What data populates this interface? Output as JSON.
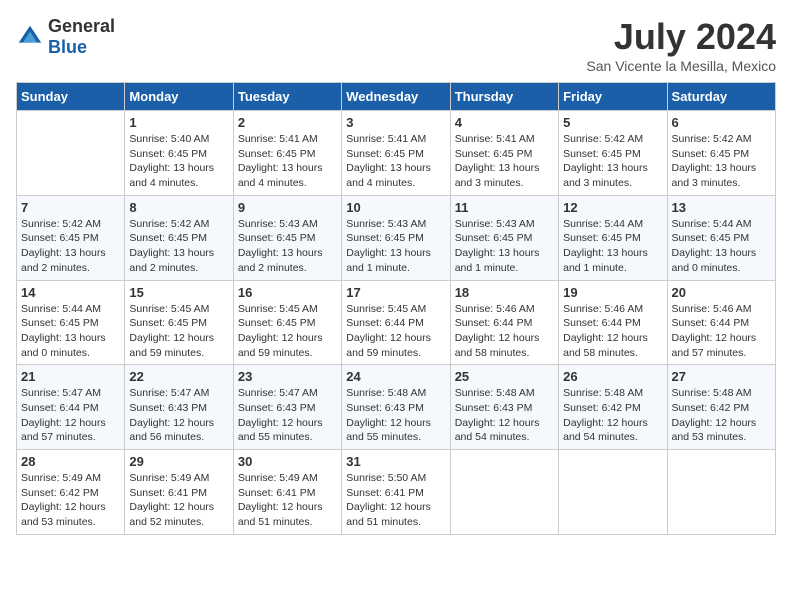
{
  "header": {
    "logo_general": "General",
    "logo_blue": "Blue",
    "month_year": "July 2024",
    "location": "San Vicente la Mesilla, Mexico"
  },
  "days_of_week": [
    "Sunday",
    "Monday",
    "Tuesday",
    "Wednesday",
    "Thursday",
    "Friday",
    "Saturday"
  ],
  "weeks": [
    [
      {
        "day": "",
        "info": ""
      },
      {
        "day": "1",
        "info": "Sunrise: 5:40 AM\nSunset: 6:45 PM\nDaylight: 13 hours and 4 minutes."
      },
      {
        "day": "2",
        "info": "Sunrise: 5:41 AM\nSunset: 6:45 PM\nDaylight: 13 hours and 4 minutes."
      },
      {
        "day": "3",
        "info": "Sunrise: 5:41 AM\nSunset: 6:45 PM\nDaylight: 13 hours and 4 minutes."
      },
      {
        "day": "4",
        "info": "Sunrise: 5:41 AM\nSunset: 6:45 PM\nDaylight: 13 hours and 3 minutes."
      },
      {
        "day": "5",
        "info": "Sunrise: 5:42 AM\nSunset: 6:45 PM\nDaylight: 13 hours and 3 minutes."
      },
      {
        "day": "6",
        "info": "Sunrise: 5:42 AM\nSunset: 6:45 PM\nDaylight: 13 hours and 3 minutes."
      }
    ],
    [
      {
        "day": "7",
        "info": "Sunrise: 5:42 AM\nSunset: 6:45 PM\nDaylight: 13 hours and 2 minutes."
      },
      {
        "day": "8",
        "info": "Sunrise: 5:42 AM\nSunset: 6:45 PM\nDaylight: 13 hours and 2 minutes."
      },
      {
        "day": "9",
        "info": "Sunrise: 5:43 AM\nSunset: 6:45 PM\nDaylight: 13 hours and 2 minutes."
      },
      {
        "day": "10",
        "info": "Sunrise: 5:43 AM\nSunset: 6:45 PM\nDaylight: 13 hours and 1 minute."
      },
      {
        "day": "11",
        "info": "Sunrise: 5:43 AM\nSunset: 6:45 PM\nDaylight: 13 hours and 1 minute."
      },
      {
        "day": "12",
        "info": "Sunrise: 5:44 AM\nSunset: 6:45 PM\nDaylight: 13 hours and 1 minute."
      },
      {
        "day": "13",
        "info": "Sunrise: 5:44 AM\nSunset: 6:45 PM\nDaylight: 13 hours and 0 minutes."
      }
    ],
    [
      {
        "day": "14",
        "info": "Sunrise: 5:44 AM\nSunset: 6:45 PM\nDaylight: 13 hours and 0 minutes."
      },
      {
        "day": "15",
        "info": "Sunrise: 5:45 AM\nSunset: 6:45 PM\nDaylight: 12 hours and 59 minutes."
      },
      {
        "day": "16",
        "info": "Sunrise: 5:45 AM\nSunset: 6:45 PM\nDaylight: 12 hours and 59 minutes."
      },
      {
        "day": "17",
        "info": "Sunrise: 5:45 AM\nSunset: 6:44 PM\nDaylight: 12 hours and 59 minutes."
      },
      {
        "day": "18",
        "info": "Sunrise: 5:46 AM\nSunset: 6:44 PM\nDaylight: 12 hours and 58 minutes."
      },
      {
        "day": "19",
        "info": "Sunrise: 5:46 AM\nSunset: 6:44 PM\nDaylight: 12 hours and 58 minutes."
      },
      {
        "day": "20",
        "info": "Sunrise: 5:46 AM\nSunset: 6:44 PM\nDaylight: 12 hours and 57 minutes."
      }
    ],
    [
      {
        "day": "21",
        "info": "Sunrise: 5:47 AM\nSunset: 6:44 PM\nDaylight: 12 hours and 57 minutes."
      },
      {
        "day": "22",
        "info": "Sunrise: 5:47 AM\nSunset: 6:43 PM\nDaylight: 12 hours and 56 minutes."
      },
      {
        "day": "23",
        "info": "Sunrise: 5:47 AM\nSunset: 6:43 PM\nDaylight: 12 hours and 55 minutes."
      },
      {
        "day": "24",
        "info": "Sunrise: 5:48 AM\nSunset: 6:43 PM\nDaylight: 12 hours and 55 minutes."
      },
      {
        "day": "25",
        "info": "Sunrise: 5:48 AM\nSunset: 6:43 PM\nDaylight: 12 hours and 54 minutes."
      },
      {
        "day": "26",
        "info": "Sunrise: 5:48 AM\nSunset: 6:42 PM\nDaylight: 12 hours and 54 minutes."
      },
      {
        "day": "27",
        "info": "Sunrise: 5:48 AM\nSunset: 6:42 PM\nDaylight: 12 hours and 53 minutes."
      }
    ],
    [
      {
        "day": "28",
        "info": "Sunrise: 5:49 AM\nSunset: 6:42 PM\nDaylight: 12 hours and 53 minutes."
      },
      {
        "day": "29",
        "info": "Sunrise: 5:49 AM\nSunset: 6:41 PM\nDaylight: 12 hours and 52 minutes."
      },
      {
        "day": "30",
        "info": "Sunrise: 5:49 AM\nSunset: 6:41 PM\nDaylight: 12 hours and 51 minutes."
      },
      {
        "day": "31",
        "info": "Sunrise: 5:50 AM\nSunset: 6:41 PM\nDaylight: 12 hours and 51 minutes."
      },
      {
        "day": "",
        "info": ""
      },
      {
        "day": "",
        "info": ""
      },
      {
        "day": "",
        "info": ""
      }
    ]
  ]
}
